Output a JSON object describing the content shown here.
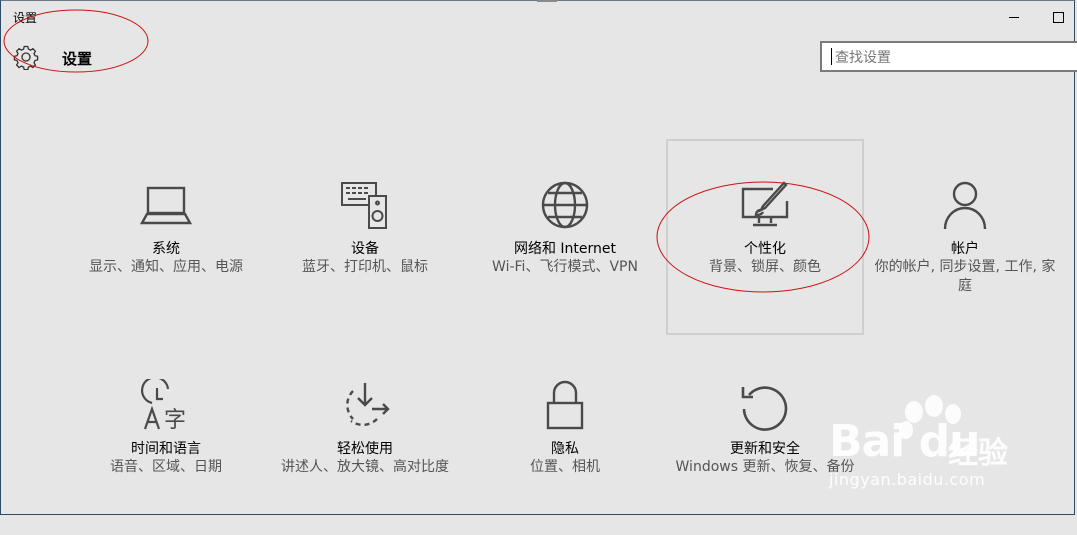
{
  "window": {
    "title": "设置",
    "minimize_icon": "minimize-icon",
    "maximize_icon": "maximize-icon"
  },
  "header": {
    "icon": "gear-icon",
    "title": "设置"
  },
  "search": {
    "placeholder": "查找设置",
    "value": ""
  },
  "tiles": [
    {
      "icon": "laptop-icon",
      "title": "系统",
      "desc": "显示、通知、应用、电源"
    },
    {
      "icon": "devices-icon",
      "title": "设备",
      "desc": "蓝牙、打印机、鼠标"
    },
    {
      "icon": "globe-icon",
      "title": "网络和 Internet",
      "desc": "Wi-Fi、飞行模式、VPN"
    },
    {
      "icon": "personalization-icon",
      "title": "个性化",
      "desc": "背景、锁屏、颜色",
      "selected": true
    },
    {
      "icon": "person-icon",
      "title": "帐户",
      "desc": "你的帐户, 同步设置, 工作, 家庭"
    },
    {
      "icon": "time-language-icon",
      "title": "时间和语言",
      "desc": "语音、区域、日期"
    },
    {
      "icon": "ease-of-access-icon",
      "title": "轻松使用",
      "desc": "讲述人、放大镜、高对比度"
    },
    {
      "icon": "lock-icon",
      "title": "隐私",
      "desc": "位置、相机"
    },
    {
      "icon": "update-icon",
      "title": "更新和安全",
      "desc": "Windows 更新、恢复、备份"
    }
  ],
  "annotations": {
    "color": "#cc0000"
  },
  "watermark": {
    "brand": "Bai du",
    "brand_suffix": "经验",
    "url": "jingyan.baidu.com"
  }
}
